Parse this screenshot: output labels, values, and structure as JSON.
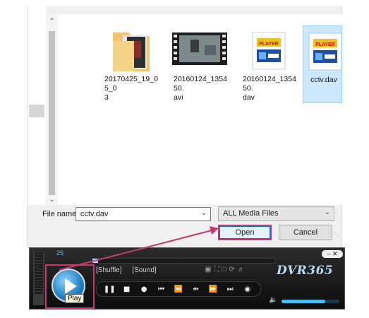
{
  "dialog": {
    "files": [
      {
        "name": "20170425_19_05_0\n3",
        "kind": "folder"
      },
      {
        "name": "20160124_135450.\navi",
        "kind": "video"
      },
      {
        "name": "20160124_135450.\ndav",
        "kind": "player"
      },
      {
        "name": "cctv.dav",
        "kind": "player",
        "selected": true
      }
    ],
    "thumb_text": "PLAYER",
    "file_name_label": "File name:",
    "file_name_value": "cctv.dav",
    "file_type_value": "ALL Media Files",
    "open_label": "Open",
    "cancel_label": "Cancel"
  },
  "player": {
    "counter": "25",
    "shuffle_label": "[Shuffle]",
    "sound_label": "[Sound]",
    "brand": "DVR365",
    "play_tooltip": "Play",
    "volume_level": 0.75,
    "accent_color": "#c83870"
  }
}
